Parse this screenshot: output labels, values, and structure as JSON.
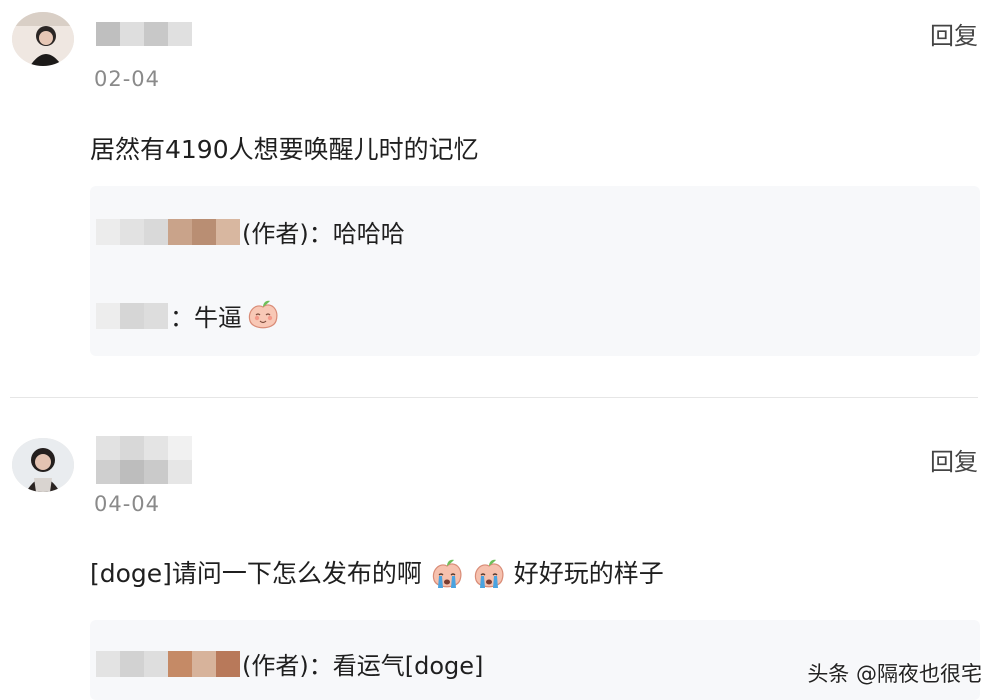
{
  "comments": [
    {
      "reply_label": "回复",
      "date": "02-04",
      "text": "居然有4190人想要唤醒儿时的记忆",
      "replies": [
        {
          "tag": "(作者)",
          "sep": "：",
          "text": "哈哈哈"
        },
        {
          "tag": "",
          "sep": "：",
          "text": "牛逼"
        }
      ]
    },
    {
      "reply_label": "回复",
      "date": "04-04",
      "text_part1": "[doge]请问一下怎么发布的啊",
      "text_part2": "好好玩的样子",
      "replies": [
        {
          "tag": "(作者)",
          "sep": "：",
          "text": "看运气[doge]"
        }
      ]
    }
  ],
  "watermark": "头条 @隔夜也很宅",
  "icons": {
    "blush_emoji": "peach-blush-emoji",
    "cry_emoji": "peach-cry-emoji"
  }
}
